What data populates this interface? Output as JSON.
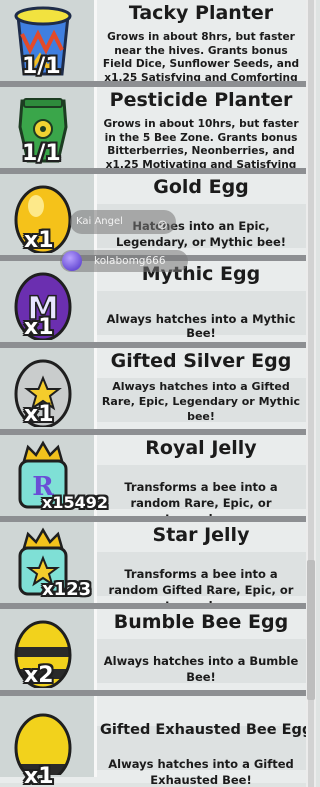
{
  "items": [
    {
      "title": "Tacky Planter",
      "desc": "Grows in about 8hrs, but faster near the hives. Grants bonus Field Dice, Sunflower Seeds, and x1.25 Satisfying and Comforting Nectar.",
      "qty": "1/1",
      "icon": "tacky-planter-icon"
    },
    {
      "title": "Pesticide Planter",
      "desc": "Grows in about 10hrs, but faster in the 5 Bee Zone. Grants bonus Bitterberries, Neonberries, and x1.25 Motivating and Satisfying Nectar.",
      "qty": "1/1",
      "icon": "pesticide-planter-icon"
    },
    {
      "title": "Gold Egg",
      "desc": "Hatches into an Epic, Legendary, or Mythic bee!",
      "qty": "x1",
      "icon": "gold-egg-icon"
    },
    {
      "title": "Mythic Egg",
      "desc": "Always hatches into a Mythic Bee!",
      "qty": "x1",
      "icon": "mythic-egg-icon"
    },
    {
      "title": "Gifted Silver Egg",
      "desc": "Always hatches into a Gifted Rare, Epic, Legendary or Mythic bee!",
      "qty": "x1",
      "icon": "gifted-silver-egg-icon"
    },
    {
      "title": "Royal Jelly",
      "desc": "Transforms a bee into a random Rare, Epic, or Legendary.",
      "qty": "x15492",
      "icon": "royal-jelly-icon"
    },
    {
      "title": "Star Jelly",
      "desc": "Transforms a bee into a random Gifted Rare, Epic, or Legendary.",
      "qty": "x123",
      "icon": "star-jelly-icon"
    },
    {
      "title": "Bumble Bee Egg",
      "desc": "Always hatches into a Bumble Bee!",
      "qty": "x2",
      "icon": "bumble-bee-egg-icon"
    },
    {
      "title": "Gifted Exhausted Bee Egg",
      "desc": "Always hatches into a Gifted Exhausted Bee!",
      "qty": "x1",
      "icon": "gifted-exhausted-bee-egg-icon"
    }
  ],
  "overlay": {
    "name_tag": "Kai Angel",
    "username": "kolabomg666"
  },
  "colors": {
    "row_bg": "#e9ecec",
    "thumb_bg": "#cfd6d5",
    "divider": "#8d8f92"
  }
}
